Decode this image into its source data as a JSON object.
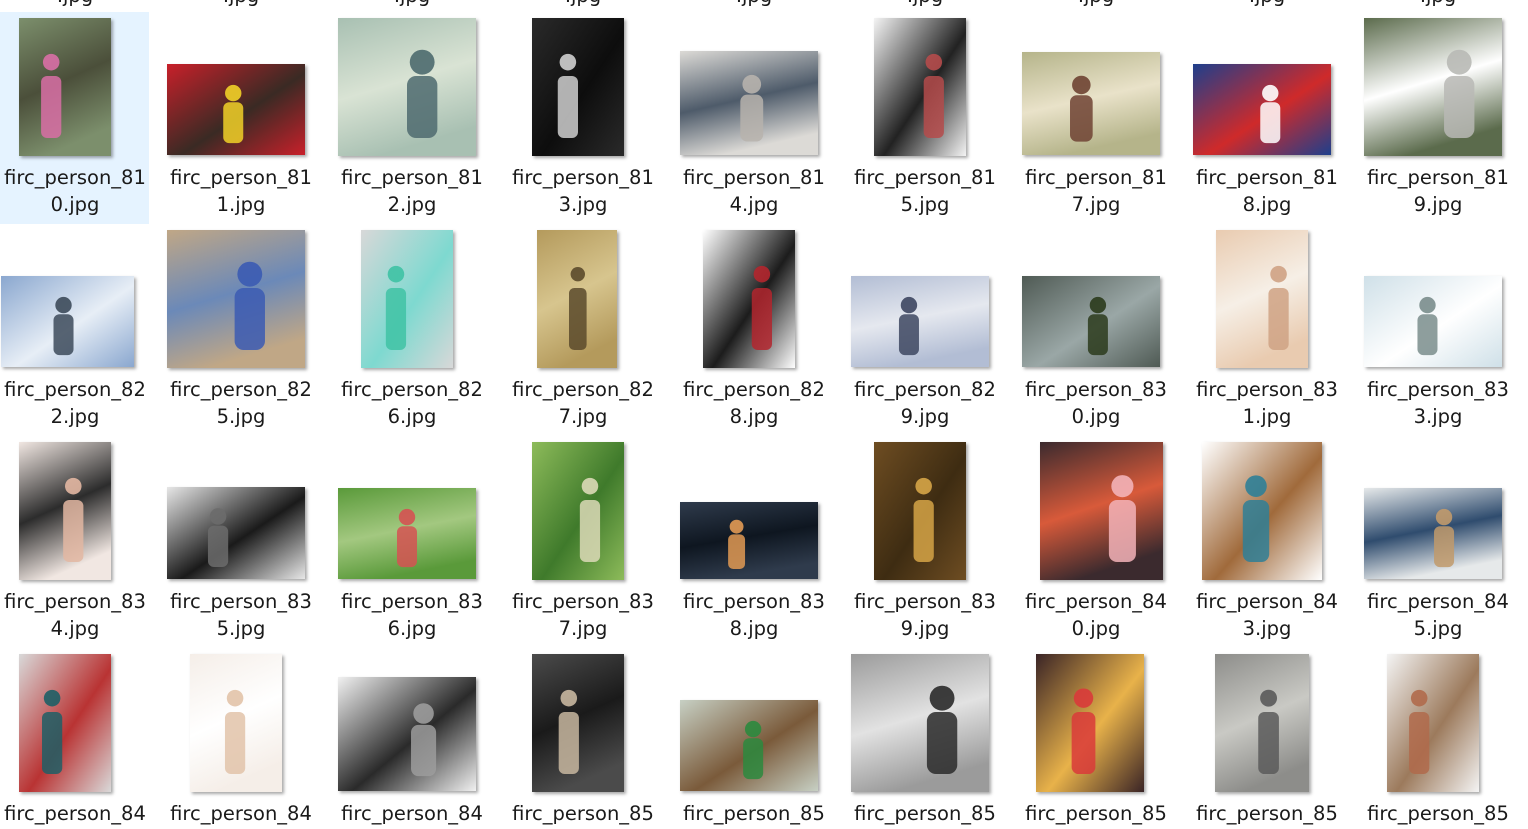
{
  "clipped_row_above": {
    "label_line2": ".jpg"
  },
  "files": [
    {
      "name_line1": "firc_person_81",
      "name_line2": "0.jpg",
      "selected": true,
      "colors": [
        "#7c8f6c",
        "#d96fa6",
        "#4b4f3a"
      ]
    },
    {
      "name_line1": "firc_person_81",
      "name_line2": "1.jpg",
      "colors": [
        "#c8202a",
        "#f1d128",
        "#3a2a24"
      ]
    },
    {
      "name_line1": "firc_person_81",
      "name_line2": "2.jpg",
      "colors": [
        "#a8c0b2",
        "#4d6a6e",
        "#d9e3d4"
      ]
    },
    {
      "name_line1": "firc_person_81",
      "name_line2": "3.jpg",
      "colors": [
        "#2a2a2a",
        "#cfcfcf",
        "#0d0d0d"
      ]
    },
    {
      "name_line1": "firc_person_81",
      "name_line2": "4.jpg",
      "colors": [
        "#dcdad6",
        "#b7b3ad",
        "#4e5b6a"
      ]
    },
    {
      "name_line1": "firc_person_81",
      "name_line2": "5.jpg",
      "colors": [
        "#f4f4f4",
        "#b54b4b",
        "#222222"
      ]
    },
    {
      "name_line1": "firc_person_81",
      "name_line2": "7.jpg",
      "colors": [
        "#b5b48a",
        "#6e4232",
        "#e9e2c9"
      ]
    },
    {
      "name_line1": "firc_person_81",
      "name_line2": "8.jpg",
      "colors": [
        "#1e3f8c",
        "#ffffff",
        "#cf2a2a"
      ]
    },
    {
      "name_line1": "firc_person_81",
      "name_line2": "9.jpg",
      "colors": [
        "#5b6b4c",
        "#b8b9b5",
        "#ffffff"
      ]
    },
    {
      "name_line1": "firc_person_82",
      "name_line2": "2.jpg",
      "colors": [
        "#8aa7cf",
        "#3c4a5a",
        "#e7eef6"
      ]
    },
    {
      "name_line1": "firc_person_82",
      "name_line2": "5.jpg",
      "colors": [
        "#c0a786",
        "#3b5bb3",
        "#6b89b8"
      ]
    },
    {
      "name_line1": "firc_person_82",
      "name_line2": "6.jpg",
      "colors": [
        "#d8d8d8",
        "#3fc2a4",
        "#7ed9d0"
      ]
    },
    {
      "name_line1": "firc_person_82",
      "name_line2": "7.jpg",
      "colors": [
        "#b49a5c",
        "#5b4a2b",
        "#d7c58e"
      ]
    },
    {
      "name_line1": "firc_person_82",
      "name_line2": "8.jpg",
      "colors": [
        "#ffffff",
        "#b3262e",
        "#1c1c1c"
      ]
    },
    {
      "name_line1": "firc_person_82",
      "name_line2": "9.jpg",
      "colors": [
        "#b2bdd4",
        "#3d4660",
        "#e5e8ef"
      ]
    },
    {
      "name_line1": "firc_person_83",
      "name_line2": "0.jpg",
      "colors": [
        "#4f5a54",
        "#2b3b1c",
        "#9aa7a6"
      ]
    },
    {
      "name_line1": "firc_person_83",
      "name_line2": "1.jpg",
      "colors": [
        "#e9cbb0",
        "#cfa284",
        "#f6efe6"
      ]
    },
    {
      "name_line1": "firc_person_83",
      "name_line2": "3.jpg",
      "colors": [
        "#cfe0e8",
        "#7a8d8c",
        "#ffffff"
      ]
    },
    {
      "name_line1": "firc_person_83",
      "name_line2": "4.jpg",
      "colors": [
        "#f1e7e2",
        "#e3b7a2",
        "#2c2c2c"
      ]
    },
    {
      "name_line1": "firc_person_83",
      "name_line2": "5.jpg",
      "colors": [
        "#e7e7e7",
        "#6c6c6c",
        "#1a1a1a"
      ]
    },
    {
      "name_line1": "firc_person_83",
      "name_line2": "6.jpg",
      "colors": [
        "#5a9a3a",
        "#d55252",
        "#a3c880"
      ]
    },
    {
      "name_line1": "firc_person_83",
      "name_line2": "7.jpg",
      "colors": [
        "#8dbb5a",
        "#dcd9b7",
        "#3f7a2b"
      ]
    },
    {
      "name_line1": "firc_person_83",
      "name_line2": "8.jpg",
      "colors": [
        "#2f3b4c",
        "#e29a54",
        "#0e1620"
      ]
    },
    {
      "name_line1": "firc_person_83",
      "name_line2": "9.jpg",
      "colors": [
        "#6e4d22",
        "#d6a547",
        "#3e2c12"
      ]
    },
    {
      "name_line1": "firc_person_84",
      "name_line2": "0.jpg",
      "colors": [
        "#3b2a2e",
        "#f3b3b8",
        "#d85a3a"
      ]
    },
    {
      "name_line1": "firc_person_84",
      "name_line2": "3.jpg",
      "colors": [
        "#ffffff",
        "#2f7f97",
        "#a06a3b"
      ]
    },
    {
      "name_line1": "firc_person_84",
      "name_line2": "5.jpg",
      "colors": [
        "#e6e9ea",
        "#c19a6b",
        "#2f4c6e"
      ]
    },
    {
      "name_line1": "firc_person_84",
      "name_line2": "",
      "colors": [
        "#d9d9d9",
        "#1e5f66",
        "#b93333"
      ]
    },
    {
      "name_line1": "firc_person_84",
      "name_line2": "",
      "colors": [
        "#f5eee8",
        "#e2c3a9",
        "#ffffff"
      ]
    },
    {
      "name_line1": "firc_person_84",
      "name_line2": "",
      "colors": [
        "#f1f1f1",
        "#9c9c9c",
        "#2a2a2a"
      ]
    },
    {
      "name_line1": "firc_person_85",
      "name_line2": "",
      "colors": [
        "#4b4b4b",
        "#c8b7a0",
        "#1a1a1a"
      ]
    },
    {
      "name_line1": "firc_person_85",
      "name_line2": "",
      "colors": [
        "#c7d0c4",
        "#2c8a3e",
        "#7a5a3a"
      ]
    },
    {
      "name_line1": "firc_person_85",
      "name_line2": "",
      "colors": [
        "#9b9b9b",
        "#2a2a2a",
        "#e2e2e2"
      ]
    },
    {
      "name_line1": "firc_person_85",
      "name_line2": "",
      "colors": [
        "#3a2426",
        "#d93a3a",
        "#e8b24a"
      ]
    },
    {
      "name_line1": "firc_person_85",
      "name_line2": "",
      "colors": [
        "#8d8d8a",
        "#5a5a5a",
        "#c9c9c4"
      ]
    },
    {
      "name_line1": "firc_person_85",
      "name_line2": "",
      "colors": [
        "#f4f4f4",
        "#b06a4b",
        "#9c7a5c"
      ]
    }
  ]
}
